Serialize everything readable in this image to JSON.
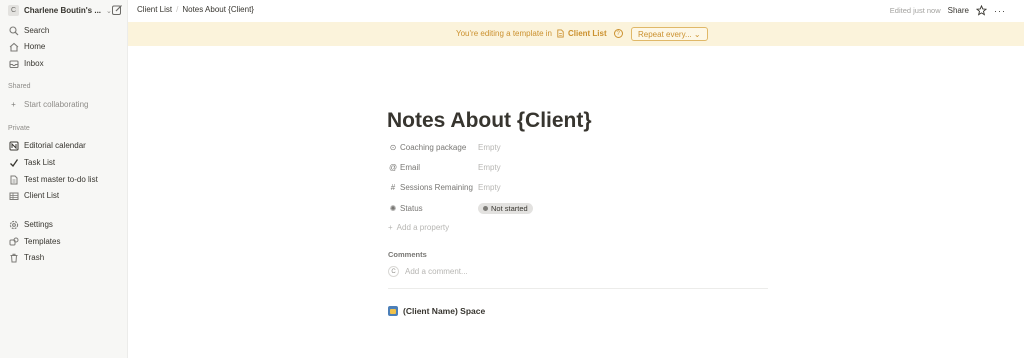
{
  "sidebar": {
    "workspace": {
      "initial": "C",
      "name": "Charlene Boutin's ..."
    },
    "nav": [
      {
        "label": "Search",
        "icon": "search-icon"
      },
      {
        "label": "Home",
        "icon": "home-icon"
      },
      {
        "label": "Inbox",
        "icon": "inbox-icon"
      }
    ],
    "shared_label": "Shared",
    "start_collaborating": "Start collaborating",
    "private_label": "Private",
    "private_items": [
      {
        "label": "Editorial calendar",
        "icon": "notion-page-icon"
      },
      {
        "label": "Task List",
        "icon": "checkmark-icon"
      },
      {
        "label": "Test master to-do list",
        "icon": "document-icon"
      },
      {
        "label": "Client List",
        "icon": "table-icon"
      }
    ],
    "bottom": [
      {
        "label": "Settings",
        "icon": "gear-icon"
      },
      {
        "label": "Templates",
        "icon": "templates-icon"
      },
      {
        "label": "Trash",
        "icon": "trash-icon"
      }
    ]
  },
  "topbar": {
    "breadcrumbs": [
      "Client List",
      "Notes About {Client}"
    ],
    "edited": "Edited just now",
    "share": "Share",
    "more": "···"
  },
  "banner": {
    "text": "You're editing a template in",
    "template": "Client List",
    "help": "?",
    "repeat_button": "Repeat every... ⌄",
    "color": "#cb912f"
  },
  "page": {
    "title": "Notes About {Client}",
    "properties": [
      {
        "icon": "⊙",
        "label": "Coaching package",
        "value": "Empty"
      },
      {
        "icon": "@",
        "label": "Email",
        "value": "Empty"
      },
      {
        "icon": "#",
        "label": "Sessions Remaining",
        "value": "Empty"
      },
      {
        "icon": "✺",
        "label": "Status",
        "value": "Not started"
      }
    ],
    "add_property": "Add a property",
    "comments_label": "Comments",
    "comment_avatar": "C",
    "comment_placeholder": "Add a comment...",
    "subpage": "(Client Name) Space"
  }
}
